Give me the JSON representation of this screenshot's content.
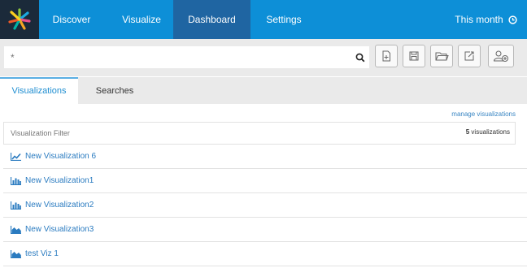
{
  "nav": {
    "items": [
      {
        "label": "Discover",
        "active": false
      },
      {
        "label": "Visualize",
        "active": false
      },
      {
        "label": "Dashboard",
        "active": true
      },
      {
        "label": "Settings",
        "active": false
      }
    ],
    "time_filter": "This month",
    "colors": {
      "navbar": "#0d8fd7",
      "active_item": "#1f65a2",
      "logo_bg": "#1b2a3a"
    }
  },
  "search": {
    "query": "*",
    "toolbar": [
      "new-dashboard-icon",
      "save-icon",
      "open-folder-icon",
      "share-icon",
      "add-visualization-icon"
    ]
  },
  "tabs": [
    {
      "label": "Visualizations",
      "active": true
    },
    {
      "label": "Searches",
      "active": false
    }
  ],
  "panel": {
    "manage_link": "manage visualizations",
    "filter_placeholder": "Visualization Filter",
    "count": "5",
    "count_suffix": " visualizations"
  },
  "visualizations": [
    {
      "name": "New Visualization 6",
      "icon": "line-chart-icon"
    },
    {
      "name": "New Visualization1",
      "icon": "bar-chart-icon"
    },
    {
      "name": "New Visualization2",
      "icon": "bar-chart-icon"
    },
    {
      "name": "New Visualization3",
      "icon": "area-chart-icon"
    },
    {
      "name": "test Viz 1",
      "icon": "area-chart-icon"
    }
  ]
}
